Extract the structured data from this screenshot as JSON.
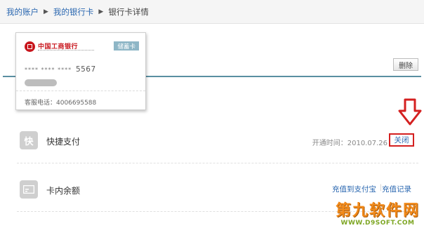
{
  "breadcrumb": {
    "items": [
      "我的账户",
      "我的银行卡"
    ],
    "separator": "▶",
    "current": "银行卡详情"
  },
  "card": {
    "bank_name": "中国工商银行",
    "type": "储蓄卡",
    "mask": "**** **** ****",
    "last_digits": "5567",
    "service_phone": "客服电话：4006695588",
    "delete_label": "删除"
  },
  "quick_pay": {
    "icon_char": "快",
    "title": "快捷支付",
    "open_time": "开通时间：2010.07.26",
    "close_label": "关闭"
  },
  "balance": {
    "title": "卡内余额",
    "recharge_alipay": "充值到支付宝",
    "link_divider": "|",
    "recharge_history": "充值记录"
  },
  "watermark": {
    "main": "第九软件网",
    "sub": "WWW.D9SOFT.COM"
  },
  "colors": {
    "link": "#2a67b0",
    "bank_red": "#c8161d",
    "highlight_red": "#d42020",
    "teal": "#5a8fa1"
  },
  "icons": {
    "bank_logo": "icbc-logo-icon",
    "quick_pay": "quick-pay-icon",
    "balance": "card-balance-icon",
    "annotation": "down-arrow-icon"
  }
}
